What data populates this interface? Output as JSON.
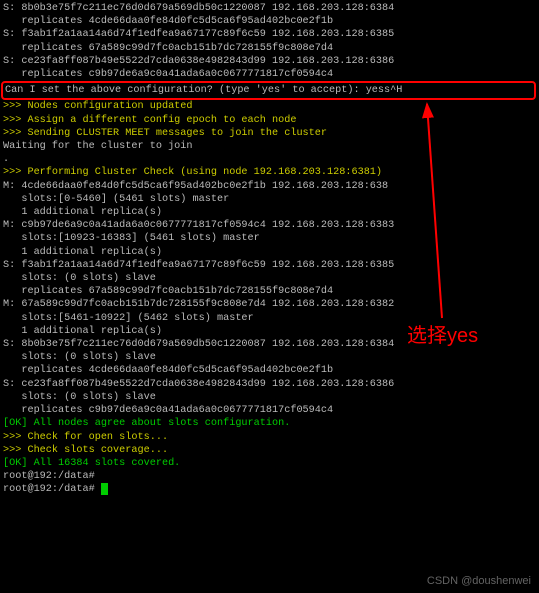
{
  "lines": {
    "l01": "S: 8b0b3e75f7c211ec76d0d679a569db50c1220087 192.168.203.128:6384",
    "l02": "   replicates 4cde66daa0fe84d0fc5d5ca6f95ad402bc0e2f1b",
    "l03": "S: f3ab1f2a1aa14a6d74f1edfea9a67177c89f6c59 192.168.203.128:6385",
    "l04": "   replicates 67a589c99d7fc0acb151b7dc728155f9c808e7d4",
    "l05": "S: ce23fa8ff087b49e5522d7cda0638e4982843d99 192.168.203.128:6386",
    "l06": "   replicates c9b97de6a9c0a41ada6a0c0677771817cf0594c4",
    "prompt": "Can I set the above configuration? (type 'yes' to accept): yess^H",
    "l07": ">>> Nodes configuration updated",
    "l08": ">>> Assign a different config epoch to each node",
    "l09": ">>> Sending CLUSTER MEET messages to join the cluster",
    "l10": "Waiting for the cluster to join",
    "l11": ".",
    "l12": ">>> Performing Cluster Check (using node 192.168.203.128:6381)",
    "l13": "M: 4cde66daa0fe84d0fc5d5ca6f95ad402bc0e2f1b 192.168.203.128:638",
    "l14": "   slots:[0-5460] (5461 slots) master",
    "l15": "   1 additional replica(s)",
    "l16": "M: c9b97de6a9c0a41ada6a0c0677771817cf0594c4 192.168.203.128:6383",
    "l17": "   slots:[10923-16383] (5461 slots) master",
    "l18": "   1 additional replica(s)",
    "l19": "S: f3ab1f2a1aa14a6d74f1edfea9a67177c89f6c59 192.168.203.128:6385",
    "l20": "   slots: (0 slots) slave",
    "l21": "   replicates 67a589c99d7fc0acb151b7dc728155f9c808e7d4",
    "l22": "M: 67a589c99d7fc0acb151b7dc728155f9c808e7d4 192.168.203.128:6382",
    "l23": "   slots:[5461-10922] (5462 slots) master",
    "l24": "   1 additional replica(s)",
    "l25": "S: 8b0b3e75f7c211ec76d0d679a569db50c1220087 192.168.203.128:6384",
    "l26": "   slots: (0 slots) slave",
    "l27": "   replicates 4cde66daa0fe84d0fc5d5ca6f95ad402bc0e2f1b",
    "l28": "S: ce23fa8ff087b49e5522d7cda0638e4982843d99 192.168.203.128:6386",
    "l29": "   slots: (0 slots) slave",
    "l30": "   replicates c9b97de6a9c0a41ada6a0c0677771817cf0594c4",
    "l31": "[OK] All nodes agree about slots configuration.",
    "l32": ">>> Check for open slots...",
    "l33": ">>> Check slots coverage...",
    "l34": "[OK] All 16384 slots covered.",
    "l35": "root@192:/data# ",
    "l36": "root@192:/data# "
  },
  "annotation": "选择yes",
  "watermark": "CSDN @doushenwei"
}
